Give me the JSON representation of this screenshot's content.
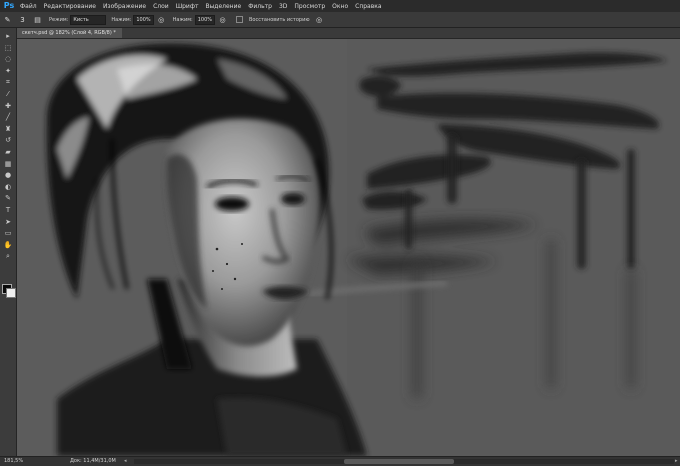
{
  "menu": {
    "logo": "Ps",
    "items": [
      "Файл",
      "Редактирование",
      "Изображение",
      "Слои",
      "Шрифт",
      "Выделение",
      "Фильтр",
      "3D",
      "Просмотр",
      "Окно",
      "Справка"
    ]
  },
  "options": {
    "brush_size": "3",
    "mode_label": "Режим:",
    "mode_value": "Кисть",
    "pressure_label": "Нажим:",
    "pressure_value": "100%",
    "flow_label": "Нажим:",
    "flow_value": "100%",
    "restore_label": "Восстановить историю"
  },
  "document": {
    "tab_title": "скетч.psd @ 182% (Слой 4, RGB/8) *"
  },
  "toolbar": {
    "tools": [
      {
        "name": "move-tool",
        "glyph": "▸"
      },
      {
        "name": "marquee-tool",
        "glyph": "⬚"
      },
      {
        "name": "lasso-tool",
        "glyph": "◌"
      },
      {
        "name": "quick-select-tool",
        "glyph": "✦"
      },
      {
        "name": "crop-tool",
        "glyph": "⌗"
      },
      {
        "name": "eyedropper-tool",
        "glyph": "⁄"
      },
      {
        "name": "healing-tool",
        "glyph": "✚"
      },
      {
        "name": "brush-tool",
        "glyph": "╱"
      },
      {
        "name": "clone-stamp-tool",
        "glyph": "♜"
      },
      {
        "name": "history-brush-tool",
        "glyph": "↺"
      },
      {
        "name": "eraser-tool",
        "glyph": "▰"
      },
      {
        "name": "gradient-tool",
        "glyph": "▦"
      },
      {
        "name": "blur-tool",
        "glyph": "●"
      },
      {
        "name": "dodge-tool",
        "glyph": "◐"
      },
      {
        "name": "pen-tool",
        "glyph": "✎"
      },
      {
        "name": "type-tool",
        "glyph": "T"
      },
      {
        "name": "path-select-tool",
        "glyph": "➤"
      },
      {
        "name": "shape-tool",
        "glyph": "▭"
      },
      {
        "name": "hand-tool",
        "glyph": "✋"
      },
      {
        "name": "zoom-tool",
        "glyph": "⌕"
      }
    ]
  },
  "status": {
    "zoom": "181,5%",
    "doc_info": "Док: 11,4M/31,0M"
  },
  "colors": {
    "foreground": "#0a0a0a",
    "background": "#f0f0f0",
    "accent": "#31a8ff"
  }
}
